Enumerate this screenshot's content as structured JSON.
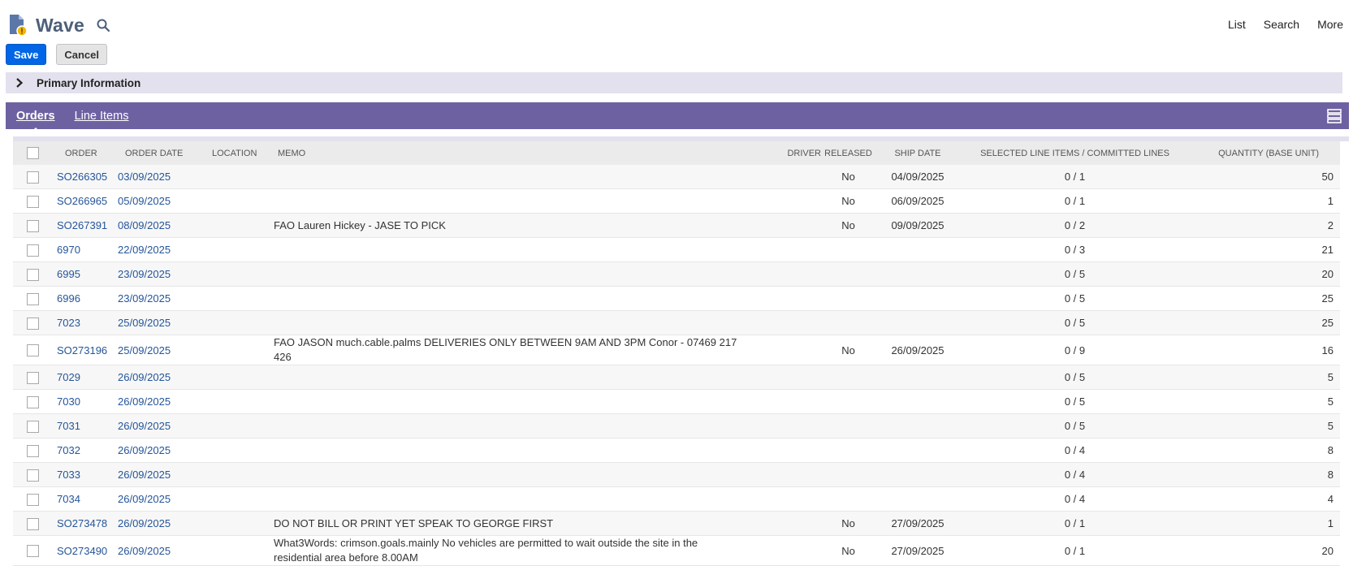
{
  "header": {
    "title": "Wave"
  },
  "topnav": {
    "list": "List",
    "search": "Search",
    "more": "More"
  },
  "buttons": {
    "save": "Save",
    "cancel": "Cancel"
  },
  "section": {
    "primary_information": "Primary Information"
  },
  "tabs": {
    "orders": "Orders",
    "line_items": "Line Items"
  },
  "orders_table": {
    "columns": {
      "order": "ORDER",
      "order_date": "ORDER DATE",
      "location": "LOCATION",
      "memo": "MEMO",
      "driver": "DRIVER",
      "released": "RELEASED",
      "ship_date": "SHIP DATE",
      "selected": "SELECTED LINE ITEMS / COMMITTED LINES",
      "quantity": "QUANTITY (BASE UNIT)"
    },
    "rows": [
      {
        "order": "SO266305",
        "order_date": "03/09/2025",
        "location": "",
        "memo": "",
        "driver": "",
        "released": "No",
        "ship_date": "04/09/2025",
        "selected": "0 / 1",
        "quantity": "50"
      },
      {
        "order": "SO266965",
        "order_date": "05/09/2025",
        "location": "",
        "memo": "",
        "driver": "",
        "released": "No",
        "ship_date": "06/09/2025",
        "selected": "0 / 1",
        "quantity": "1"
      },
      {
        "order": "SO267391",
        "order_date": "08/09/2025",
        "location": "",
        "memo": "FAO Lauren Hickey - JASE TO PICK",
        "driver": "",
        "released": "No",
        "ship_date": "09/09/2025",
        "selected": "0 / 2",
        "quantity": "2"
      },
      {
        "order": "6970",
        "order_date": "22/09/2025",
        "location": "",
        "memo": "",
        "driver": "",
        "released": "",
        "ship_date": "",
        "selected": "0 / 3",
        "quantity": "21"
      },
      {
        "order": "6995",
        "order_date": "23/09/2025",
        "location": "",
        "memo": "",
        "driver": "",
        "released": "",
        "ship_date": "",
        "selected": "0 / 5",
        "quantity": "20"
      },
      {
        "order": "6996",
        "order_date": "23/09/2025",
        "location": "",
        "memo": "",
        "driver": "",
        "released": "",
        "ship_date": "",
        "selected": "0 / 5",
        "quantity": "25"
      },
      {
        "order": "7023",
        "order_date": "25/09/2025",
        "location": "",
        "memo": "",
        "driver": "",
        "released": "",
        "ship_date": "",
        "selected": "0 / 5",
        "quantity": "25"
      },
      {
        "order": "SO273196",
        "order_date": "25/09/2025",
        "location": "",
        "memo": "FAO JASON much.cable.palms DELIVERIES ONLY BETWEEN 9AM AND 3PM Conor - 07469 217 426",
        "driver": "",
        "released": "No",
        "ship_date": "26/09/2025",
        "selected": "0 / 9",
        "quantity": "16"
      },
      {
        "order": "7029",
        "order_date": "26/09/2025",
        "location": "",
        "memo": "",
        "driver": "",
        "released": "",
        "ship_date": "",
        "selected": "0 / 5",
        "quantity": "5"
      },
      {
        "order": "7030",
        "order_date": "26/09/2025",
        "location": "",
        "memo": "",
        "driver": "",
        "released": "",
        "ship_date": "",
        "selected": "0 / 5",
        "quantity": "5"
      },
      {
        "order": "7031",
        "order_date": "26/09/2025",
        "location": "",
        "memo": "",
        "driver": "",
        "released": "",
        "ship_date": "",
        "selected": "0 / 5",
        "quantity": "5"
      },
      {
        "order": "7032",
        "order_date": "26/09/2025",
        "location": "",
        "memo": "",
        "driver": "",
        "released": "",
        "ship_date": "",
        "selected": "0 / 4",
        "quantity": "8"
      },
      {
        "order": "7033",
        "order_date": "26/09/2025",
        "location": "",
        "memo": "",
        "driver": "",
        "released": "",
        "ship_date": "",
        "selected": "0 / 4",
        "quantity": "8"
      },
      {
        "order": "7034",
        "order_date": "26/09/2025",
        "location": "",
        "memo": "",
        "driver": "",
        "released": "",
        "ship_date": "",
        "selected": "0 / 4",
        "quantity": "4"
      },
      {
        "order": "SO273478",
        "order_date": "26/09/2025",
        "location": "",
        "memo": "DO NOT BILL OR PRINT YET SPEAK TO GEORGE FIRST",
        "driver": "",
        "released": "No",
        "ship_date": "27/09/2025",
        "selected": "0 / 1",
        "quantity": "1"
      },
      {
        "order": "SO273490",
        "order_date": "26/09/2025",
        "location": "",
        "memo": "What3Words: crimson.goals.mainly No vehicles are permitted to wait outside the site in the residential area before 8.00AM",
        "driver": "",
        "released": "No",
        "ship_date": "27/09/2025",
        "selected": "0 / 1",
        "quantity": "20"
      }
    ]
  },
  "icons": {
    "record": "wave-record-icon",
    "search": "search-icon",
    "list": "list-view-icon",
    "expand": "chevron-right-icon"
  },
  "colors": {
    "accent": "#0066e6",
    "tabbar": "#6e61a2",
    "section": "#e3e1ee",
    "link": "#255599",
    "title": "#4d5f79"
  }
}
